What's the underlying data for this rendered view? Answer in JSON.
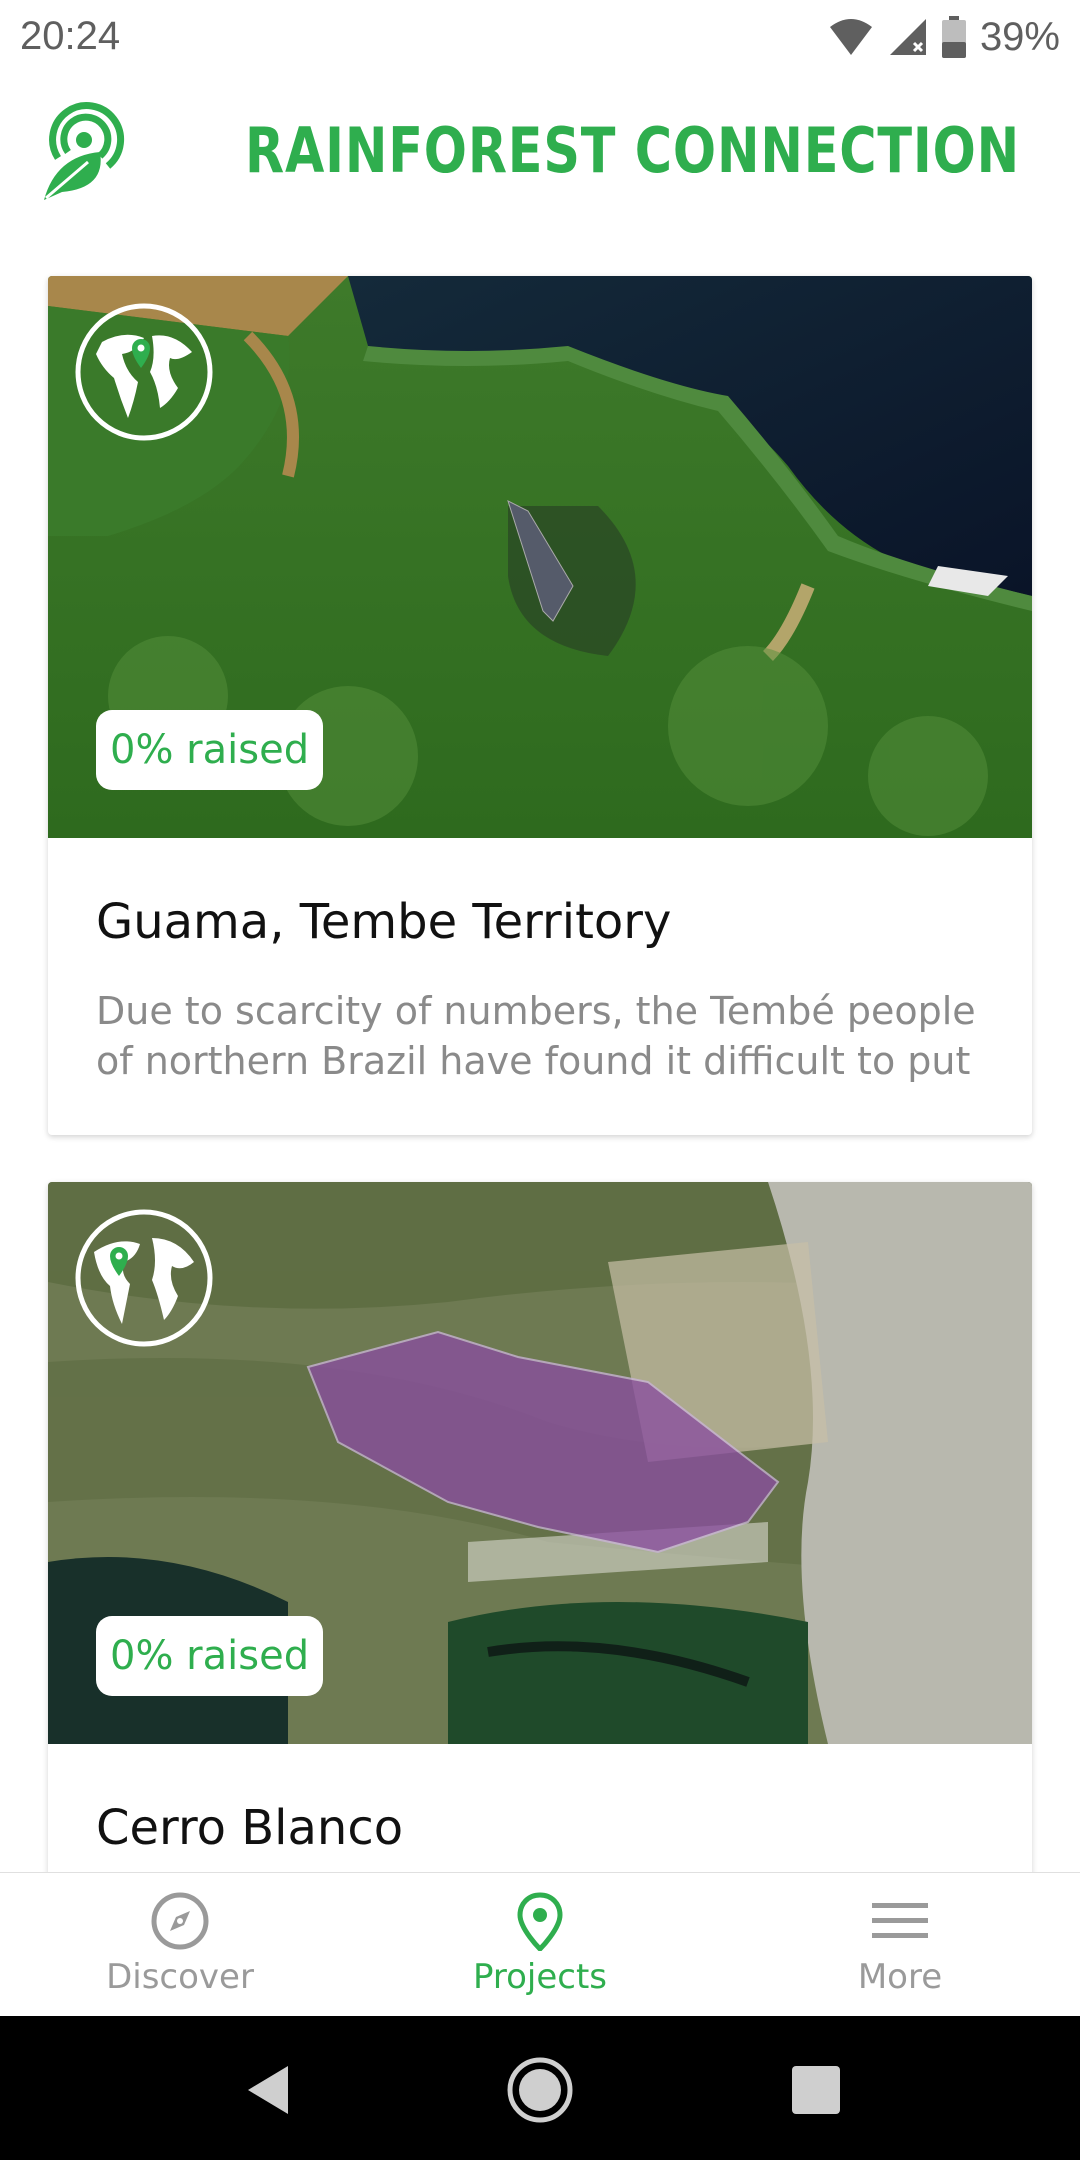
{
  "status_bar": {
    "time": "20:24",
    "battery": "39%",
    "icons": [
      "wifi-icon",
      "signal-icon",
      "battery-icon"
    ]
  },
  "header": {
    "brand": "RAINFOREST CONNECTION",
    "logo_icon": "leaf-signal-logo"
  },
  "projects": [
    {
      "title": "Guama, Tembe Territory",
      "raised": "0% raised",
      "description": "Due to scarcity of numbers, the Tembé people of northern Brazil have found it difficult to put",
      "icon": "globe-pin-icon"
    },
    {
      "title": "Cerro Blanco",
      "raised": "0% raised",
      "description": "",
      "icon": "globe-pin-icon"
    }
  ],
  "bottom_nav": {
    "items": [
      {
        "label": "Discover",
        "icon": "compass-icon",
        "active": false
      },
      {
        "label": "Projects",
        "icon": "map-pin-icon",
        "active": true
      },
      {
        "label": "More",
        "icon": "menu-icon",
        "active": false
      }
    ]
  },
  "colors": {
    "accent": "#2fae4e",
    "inactive": "#9a9a9a",
    "desc_text": "#8a8a8a"
  }
}
